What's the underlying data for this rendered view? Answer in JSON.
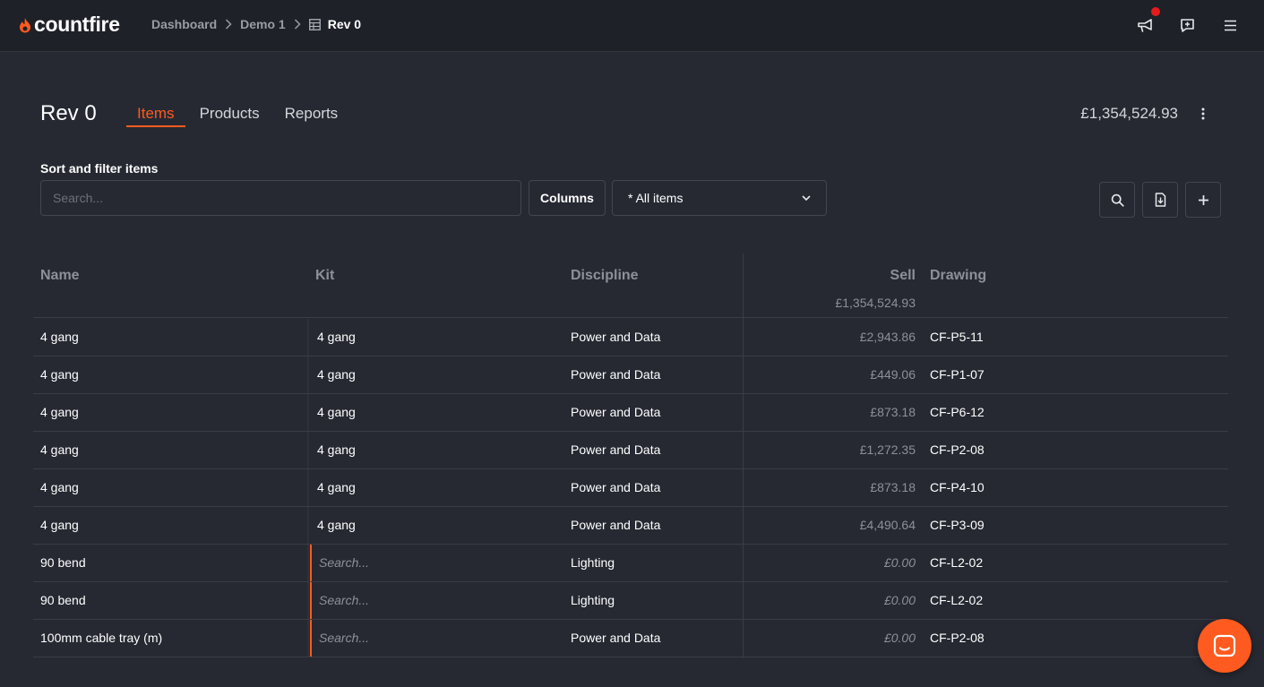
{
  "app": {
    "brand": "countfire",
    "accent": "#ff5a1f"
  },
  "breadcrumb": [
    "Dashboard",
    "Demo 1",
    "Rev 0"
  ],
  "page": {
    "title": "Rev 0",
    "tabs": [
      {
        "label": "Items",
        "active": true
      },
      {
        "label": "Products",
        "active": false
      },
      {
        "label": "Reports",
        "active": false
      }
    ],
    "total": "£1,354,524.93"
  },
  "filters": {
    "label": "Sort and filter items",
    "search_placeholder": "Search...",
    "columns_label": "Columns",
    "view_selected": "* All items"
  },
  "table": {
    "headers": {
      "name": "Name",
      "kit": "Kit",
      "discipline": "Discipline",
      "sell": "Sell",
      "drawing": "Drawing"
    },
    "sell_total": "£1,354,524.93",
    "rows": [
      {
        "name": "4 gang",
        "kit": "4 gang",
        "discipline": "Power and Data",
        "sell": "£2,943.86",
        "drawing": "CF-P5-11"
      },
      {
        "name": "4 gang",
        "kit": "4 gang",
        "discipline": "Power and Data",
        "sell": "£449.06",
        "drawing": "CF-P1-07"
      },
      {
        "name": "4 gang",
        "kit": "4 gang",
        "discipline": "Power and Data",
        "sell": "£873.18",
        "drawing": "CF-P6-12"
      },
      {
        "name": "4 gang",
        "kit": "4 gang",
        "discipline": "Power and Data",
        "sell": "£1,272.35",
        "drawing": "CF-P2-08"
      },
      {
        "name": "4 gang",
        "kit": "4 gang",
        "discipline": "Power and Data",
        "sell": "£873.18",
        "drawing": "CF-P4-10"
      },
      {
        "name": "4 gang",
        "kit": "4 gang",
        "discipline": "Power and Data",
        "sell": "£4,490.64",
        "drawing": "CF-P3-09"
      },
      {
        "name": "90 bend",
        "kit_placeholder": "Search...",
        "discipline": "Lighting",
        "sell": "£0.00",
        "drawing": "CF-L2-02"
      },
      {
        "name": "90 bend",
        "kit_placeholder": "Search...",
        "discipline": "Lighting",
        "sell": "£0.00",
        "drawing": "CF-L2-02"
      },
      {
        "name": "100mm cable tray (m)",
        "kit_placeholder": "Search...",
        "discipline": "Power and Data",
        "sell": "£0.00",
        "drawing": "CF-P2-08"
      }
    ]
  },
  "icons": [
    "flame-logo-icon",
    "table-icon",
    "megaphone-icon",
    "feedback-icon",
    "menu-icon",
    "kebab-icon",
    "search-icon",
    "export-file-icon",
    "plus-icon",
    "chevron-down-icon",
    "chat-icon"
  ]
}
